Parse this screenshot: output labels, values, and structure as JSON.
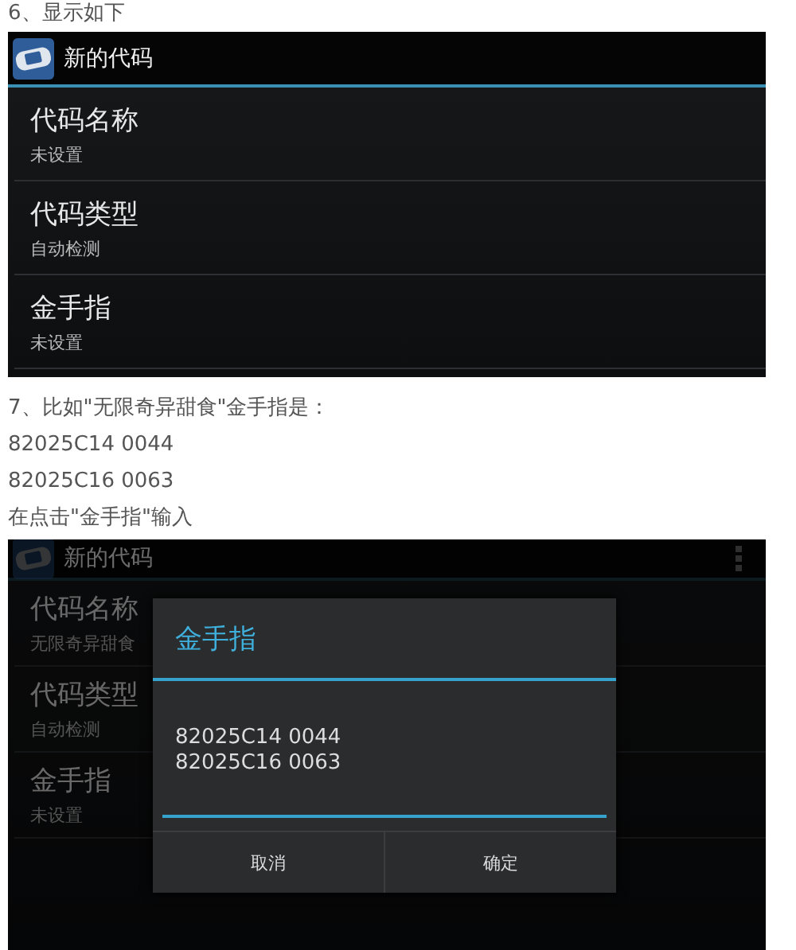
{
  "blocks": [
    {
      "kind": "paragraph",
      "text": "6、显示如下"
    },
    {
      "kind": "screen",
      "app_bar": {
        "title": "新的代码",
        "overflow_menu": false
      },
      "settings": [
        {
          "title": "代码名称",
          "summary": "未设置"
        },
        {
          "title": "代码类型",
          "summary": "自动检测"
        },
        {
          "title": "金手指",
          "summary": "未设置"
        }
      ]
    },
    {
      "kind": "paragraph",
      "text": "7、比如\"无限奇异甜食\"金手指是："
    },
    {
      "kind": "paragraph",
      "text": "82025C14 0044"
    },
    {
      "kind": "paragraph",
      "text": "82025C16 0063"
    },
    {
      "kind": "paragraph",
      "text": "在点击\"金手指\"输入"
    },
    {
      "kind": "screen",
      "app_bar": {
        "title": "新的代码",
        "overflow_menu": true
      },
      "settings": [
        {
          "title": "代码名称",
          "summary": "无限奇异甜食"
        },
        {
          "title": "代码类型",
          "summary": "自动检测"
        },
        {
          "title": "金手指",
          "summary": "未设置"
        }
      ],
      "dialog": {
        "title": "金手指",
        "value": "82025C14 0044\n82025C16 0063",
        "buttons": [
          "取消",
          "确定"
        ]
      }
    }
  ]
}
